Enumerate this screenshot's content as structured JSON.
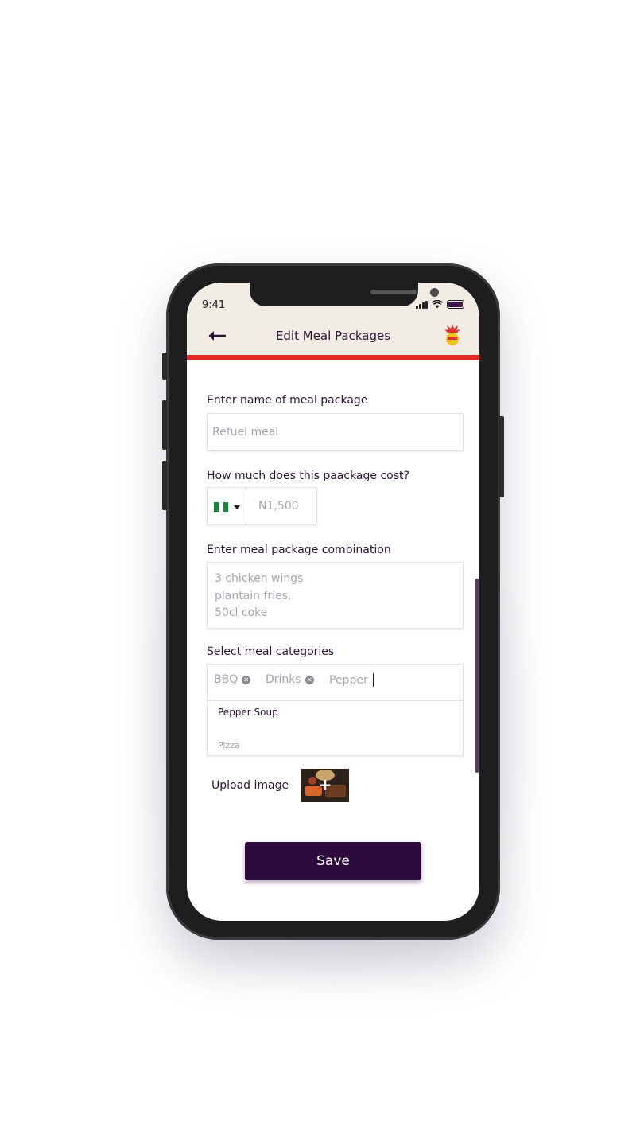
{
  "status_bar": {
    "time": "9:41"
  },
  "header": {
    "title": "Edit Meal Packages",
    "icons": [
      "back-arrow-icon",
      "brand-logo-icon"
    ]
  },
  "form": {
    "name": {
      "label": "Enter name of meal package",
      "placeholder": "Refuel meal"
    },
    "cost": {
      "label": "How much does this paackage cost?",
      "currency_flag": "nigeria-flag-icon",
      "placeholder": "N1,500"
    },
    "combination": {
      "label": "Enter meal package combination",
      "placeholder_lines": [
        "3 chicken wings",
        "plantain fries,",
        "50cl coke"
      ]
    },
    "categories": {
      "label": "Select meal categories",
      "chips": [
        "BBQ",
        "Drinks"
      ],
      "input_value": "Pepper",
      "suggestions": [
        "Pepper Soup",
        "Pizza"
      ]
    },
    "upload": {
      "label": "Upload image"
    },
    "save_label": "Save"
  },
  "colors": {
    "accent": "#2e0b3e",
    "header_bg": "#f1ece4",
    "header_rule": "#e02b2b"
  }
}
